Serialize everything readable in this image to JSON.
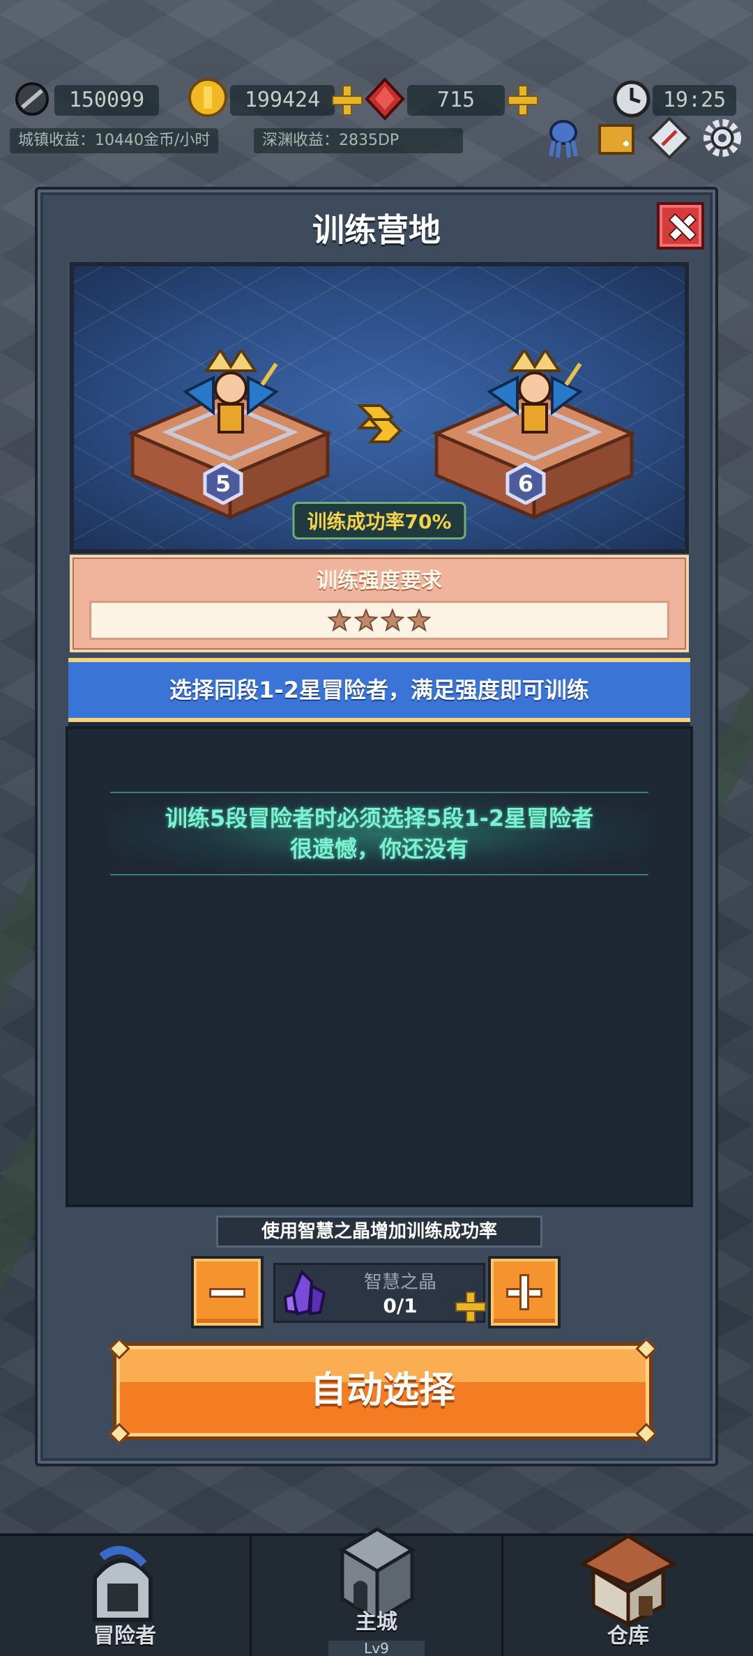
{
  "hud": {
    "depth_value": "150099",
    "gold_value": "199424",
    "gem_value": "715",
    "time": "19:25",
    "town_income": "城镇收益：10440金币/小时",
    "abyss_income": "深渊收益：2835DP",
    "icons": [
      "depth-icon",
      "gold-coin-icon",
      "red-gem-icon",
      "clock-icon",
      "squid-icon",
      "event-icon",
      "compass-icon",
      "gear-icon"
    ]
  },
  "panel": {
    "title": "训练营地",
    "from_level": "5",
    "to_level": "6",
    "success_rate": "训练成功率70%",
    "requirement_title": "训练强度要求",
    "required_stars": 4,
    "banner_text": "选择同段1-2星冒险者，满足强度即可训练",
    "empty_line1": "训练5段冒险者时必须选择5段1-2星冒险者",
    "empty_line2": "很遗憾，你还没有",
    "crystal_label": "使用智慧之晶增加训练成功率",
    "crystal_name": "智慧之晶",
    "crystal_count": "0/1",
    "auto_select": "自动选择"
  },
  "nav": {
    "items": [
      {
        "label": "冒险者",
        "icon": "knight-helmet-icon"
      },
      {
        "label": "主城",
        "icon": "castle-icon",
        "level": "Lv9"
      },
      {
        "label": "仓库",
        "icon": "warehouse-icon"
      }
    ]
  },
  "colors": {
    "panel_bg": "#3d4b5d",
    "banner_blue": "#3a74d6",
    "accent_orange": "#f47c22",
    "success_text": "#f4d34a",
    "empty_text": "#7ff0d2"
  }
}
